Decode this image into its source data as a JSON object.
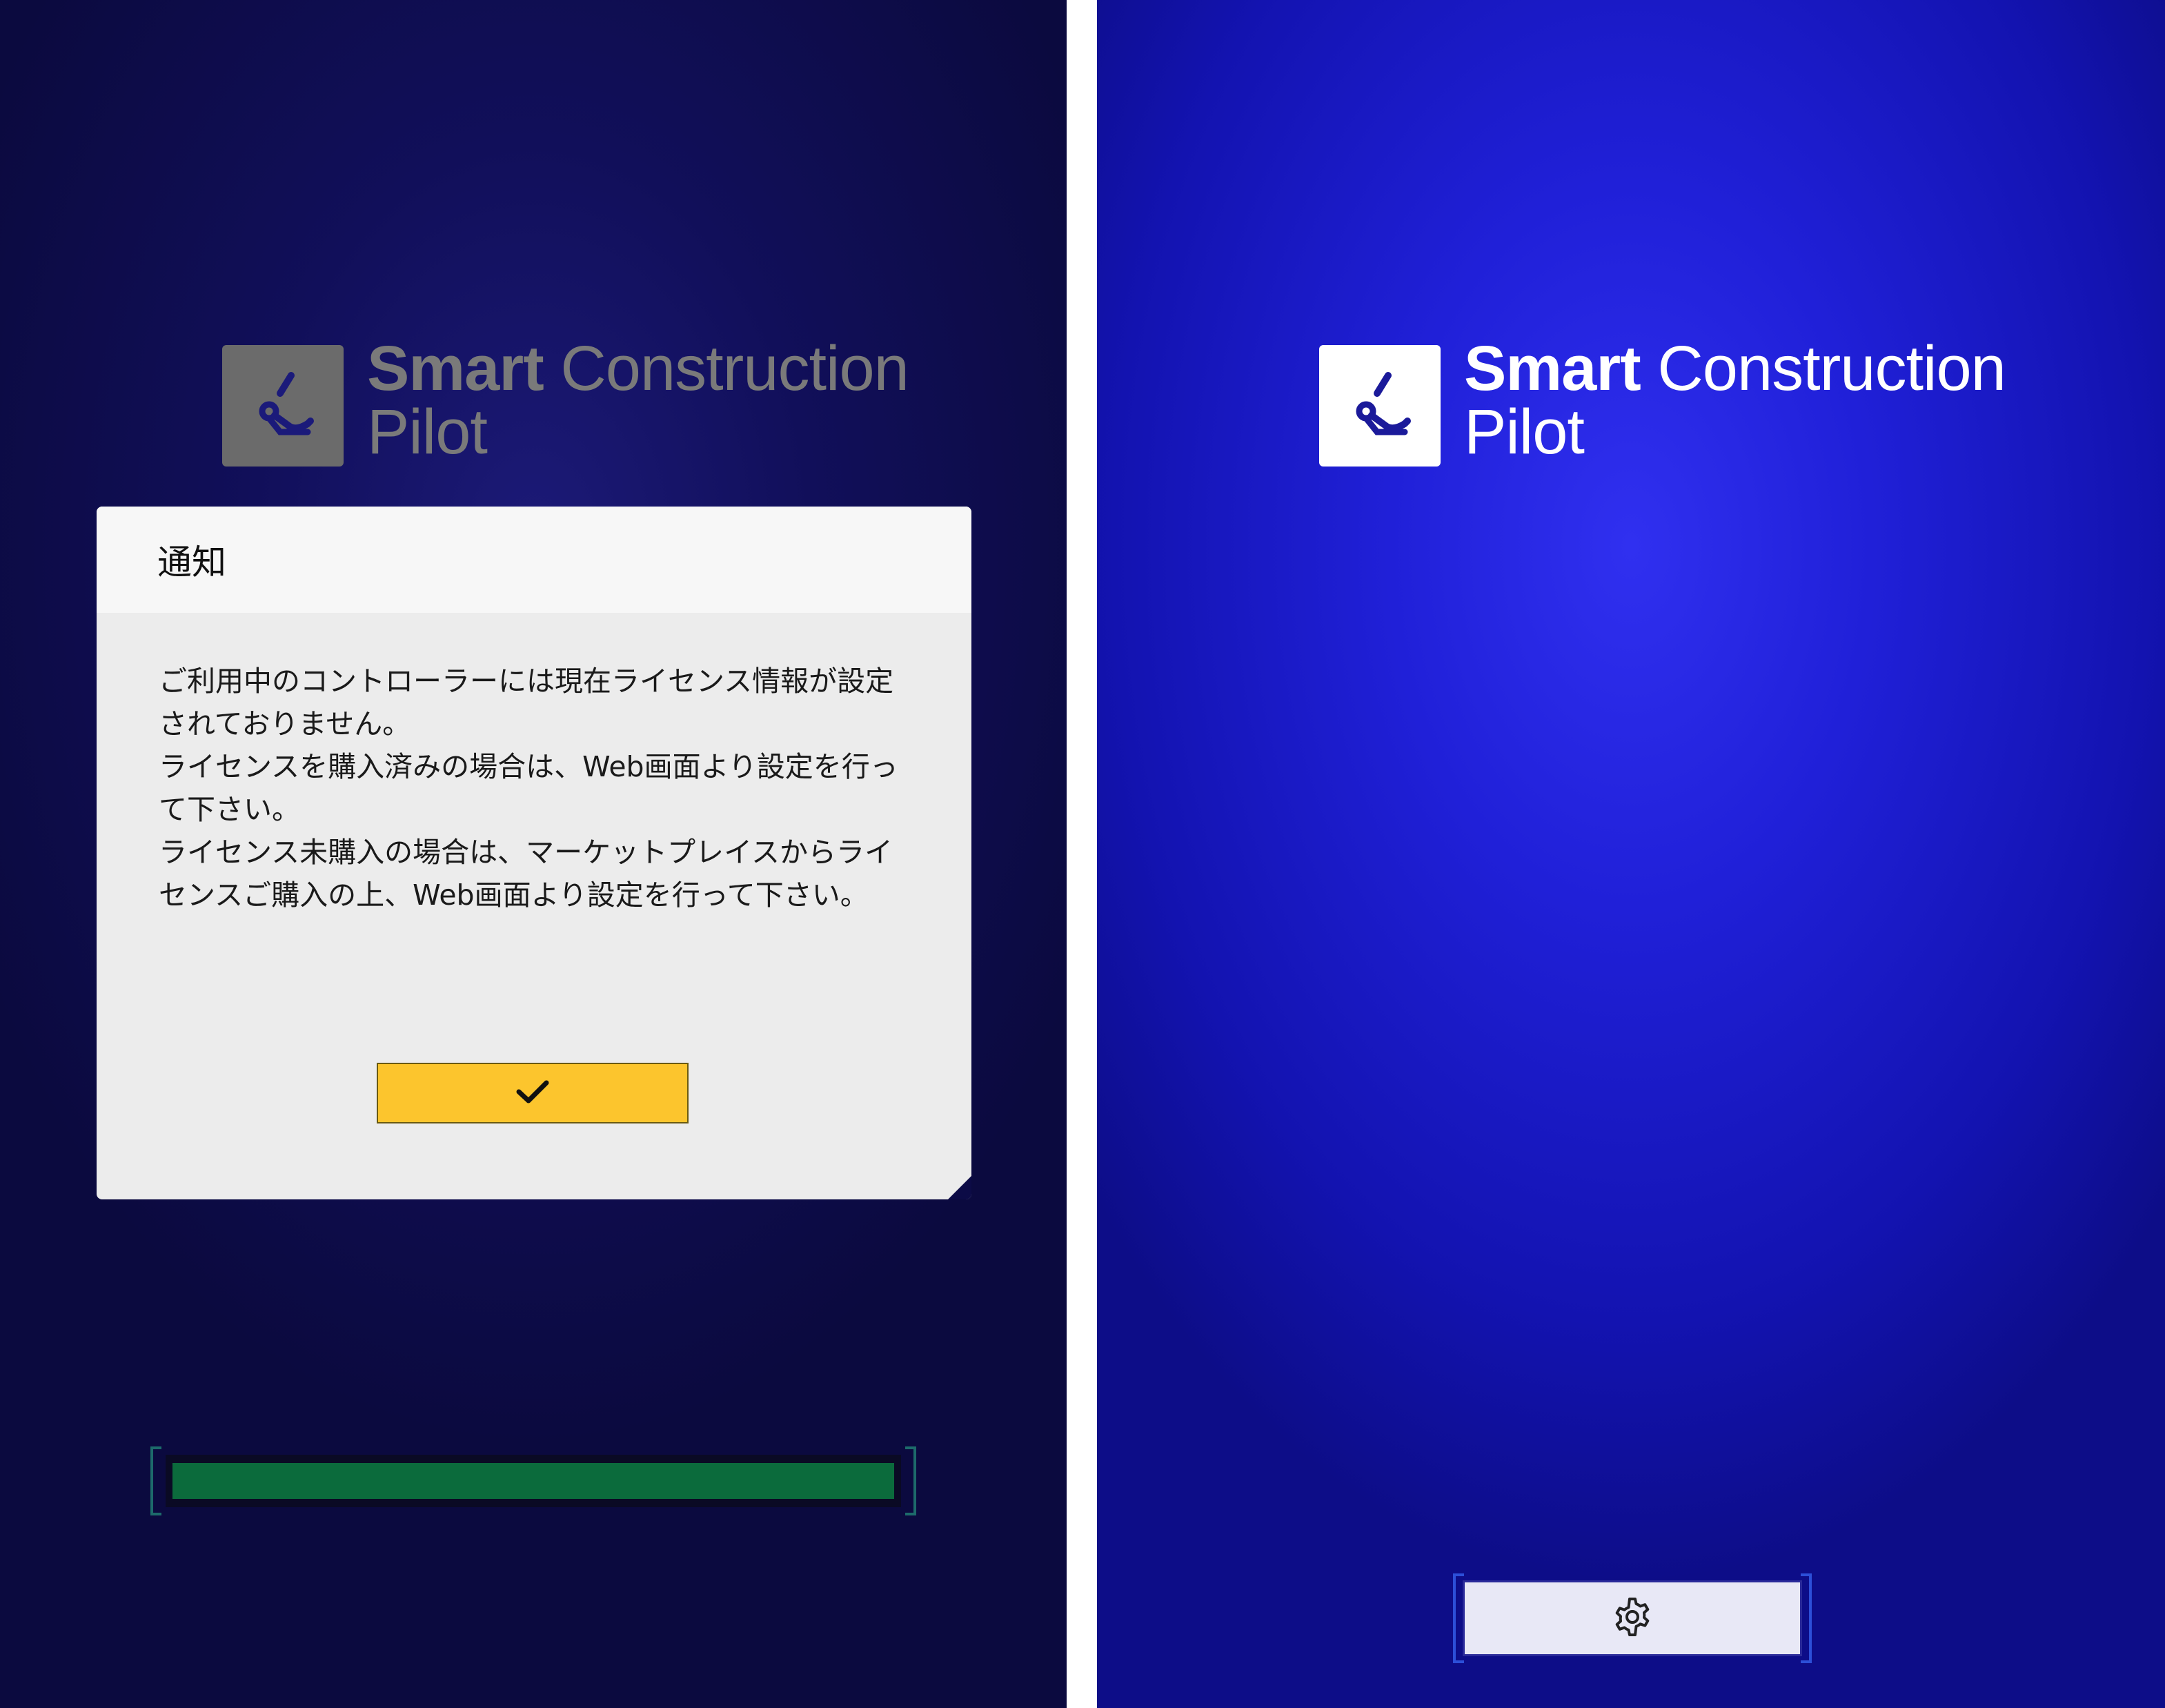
{
  "app": {
    "logo_line1_bold": "Smart",
    "logo_line1_rest": " Construction",
    "logo_line2": "Pilot",
    "logo_icon": "excavator-arm-icon"
  },
  "dialog": {
    "title": "通知",
    "paragraphs": [
      "ご利用中のコントローラーには現在ライセンス情報が設定されておりません。",
      "ライセンスを購入済みの場合は、Web画面より設定を行って下さい。",
      "ライセンス未購入の場合は、マーケットプレイスからライセンスご購入の上、Web画面より設定を行って下さい。"
    ],
    "ok_icon": "checkmark-icon"
  },
  "progress": {
    "value": 1.0
  },
  "settings": {
    "icon": "gear-icon"
  },
  "colors": {
    "accent_yellow": "#fcc52d",
    "progress_green": "#0b6b3c",
    "right_background": "#2020d8",
    "left_background": "#110f5a"
  }
}
